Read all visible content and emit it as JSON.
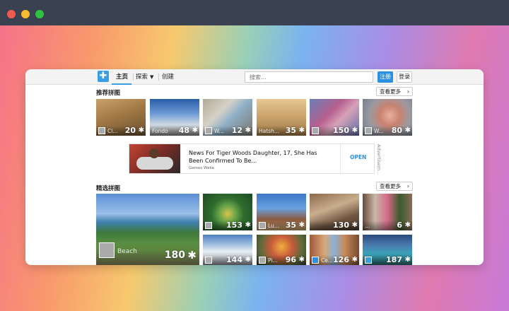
{
  "nav": {
    "home": "主页",
    "explore": "探索",
    "create": "创建",
    "search_placeholder": "搜索...",
    "register": "注册",
    "login": "登录"
  },
  "recommended": {
    "title": "推荐拼图",
    "see_more": "查看更多",
    "tiles": [
      {
        "owner": "Cl...",
        "count": "20"
      },
      {
        "owner": "Fondo",
        "count": "48"
      },
      {
        "owner": "W...",
        "count": "12"
      },
      {
        "owner": "Hatsh...",
        "count": "35"
      },
      {
        "owner": "",
        "count": "150"
      },
      {
        "owner": "W...",
        "count": "80"
      }
    ]
  },
  "ad": {
    "headline": "News For Tiger Woods Daughter, 17, She Has Been Confirmed To Be...",
    "source": "Games Waka",
    "cta": "OPEN",
    "label": "Advertisem..."
  },
  "featured": {
    "title": "精选拼图",
    "see_more": "查看更多",
    "big": {
      "owner": "Beach",
      "count": "180"
    },
    "tiles": [
      {
        "owner": "",
        "count": "153"
      },
      {
        "owner": "Lu...",
        "count": "35"
      },
      {
        "owner": "",
        "count": "130"
      },
      {
        "owner": "...",
        "count": "6"
      },
      {
        "owner": "",
        "count": "144"
      },
      {
        "owner": "Pi...",
        "count": "96"
      },
      {
        "owner": "Ce...",
        "count": "126"
      },
      {
        "owner": "",
        "count": "187"
      }
    ]
  },
  "icons": {
    "logo": "puzzle-logo-icon",
    "piece": "puzzle-piece-icon",
    "caret": "caret-down-icon",
    "chevron": "chevron-right-icon"
  },
  "colors": {
    "accent": "#2d8fe0",
    "titlebar": "#3a4150"
  }
}
